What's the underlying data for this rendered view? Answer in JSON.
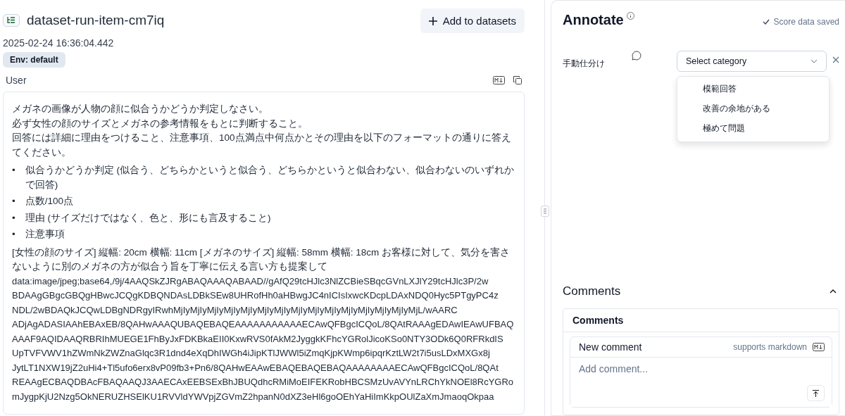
{
  "header": {
    "title": "dataset-run-item-cm7iq",
    "add_button": "Add to datasets",
    "timestamp": "2025-02-24 16:36:04.442",
    "env_badge": "Env: default"
  },
  "message": {
    "role": "User",
    "paragraphs": [
      "メガネの画像が人物の顔に似合うかどうか判定しなさい。",
      "必ず女性の顔のサイズとメガネの参考情報をもとに判断すること。",
      "回答には詳細に理由をつけること、注意事項、100点満点中何点かとその理由を以下のフォーマットの通りに答えてください。"
    ],
    "bullet_marker": "•",
    "bullets": [
      "似合うかどうか判定 (似合う、どちらかというと似合う、どちらかというと似合わない、似合わないのいずれかで回答)",
      "点数/100点",
      "理由 (サイズだけではなく、色と、形にも言及すること)",
      "注意事項"
    ],
    "closing": "[女性の顔のサイズ] 縦幅: 20cm 横幅: 11cm [メガネのサイズ] 縦幅: 58mm 横幅: 18cm お客様に対して、気分を害さないように別のメガネの方が似合う旨を丁寧に伝える言い方も提案して",
    "data_lines": [
      "data:image/jpeg;base64,/9j/4AAQSkZJRgABAQAAAQABAAD//gAfQ29tcHJlc3NlZCBieSBqcGVnLXJlY29tcHJlc3P/2w",
      "BDAAgGBgcGBQgHBwcJCQgKDBQNDAsLDBkSEw8UHRofHh0aHBwgJC4nICIsIxwcKDcpLDAxNDQ0Hyc5PTgyPC4z",
      "NDL/2wBDAQkJCQwLDBgNDRgyIRwhMjIyMjIyMjIyMjIyMjIyMjIyMjIyMjIyMjIyMjIyMjIyMjIyMjIyMjIyMjL/wAARC",
      "ADjAgADASIAAhEBAxEB/8QAHwAAAQUBAQEBAQEAAAAAAAAAAAECAwQFBgcICQoL/8QAtRAAAgEDAwIEAwUFBAQ",
      "AAAF9AQIDAAQRBRIhMUEGE1FhByJxFDKBkaEII0KxwRVS0fAkM2JyggkKFhcYGRolJicoKSo0NTY3ODk6Q0RFRkdIS",
      "UpTVFVWV1hZWmNkZWZnaGlqc3R1dnd4eXqDhIWGh4iJipKTlJWWl5iZmqKjpKWmp6ipqrKztLW2t7i5usLDxMXGx8j",
      "JytLT1NXW19jZ2uHi4+Tl5ufo6erx8vP09fb3+Pn6/8QAHwEAAwEBAQEBAQEBAQAAAAAAAAECAwQFBgcICQoL/8QAt",
      "REAAgECBAQDBAcFBAQAAQJ3AAECAxEEBSExBhJBUQdhcRMiMoEIFEKRobHBCSMzUvAVYnLRChYkNOEl8RcYGRo",
      "mJygpKjU2Nzg5OkNERUZHSElKU1RVVldYWVpjZGVmZ2hpanN0dXZ3eHl6goOEhYaHiImKkpOUlZaXmJmaoqOkpaa"
    ]
  },
  "annotate": {
    "title": "Annotate",
    "status": "Score data saved",
    "score": {
      "label": "手動仕分け",
      "placeholder": "Select category",
      "expanded": true,
      "options": [
        "模範回答",
        "改善の余地がある",
        "極めて問題"
      ]
    }
  },
  "comments": {
    "title": "Comments",
    "expanded": true,
    "box_title": "Comments",
    "new_comment": "New comment",
    "markdown_hint": "supports markdown",
    "placeholder": "Add comment..."
  }
}
